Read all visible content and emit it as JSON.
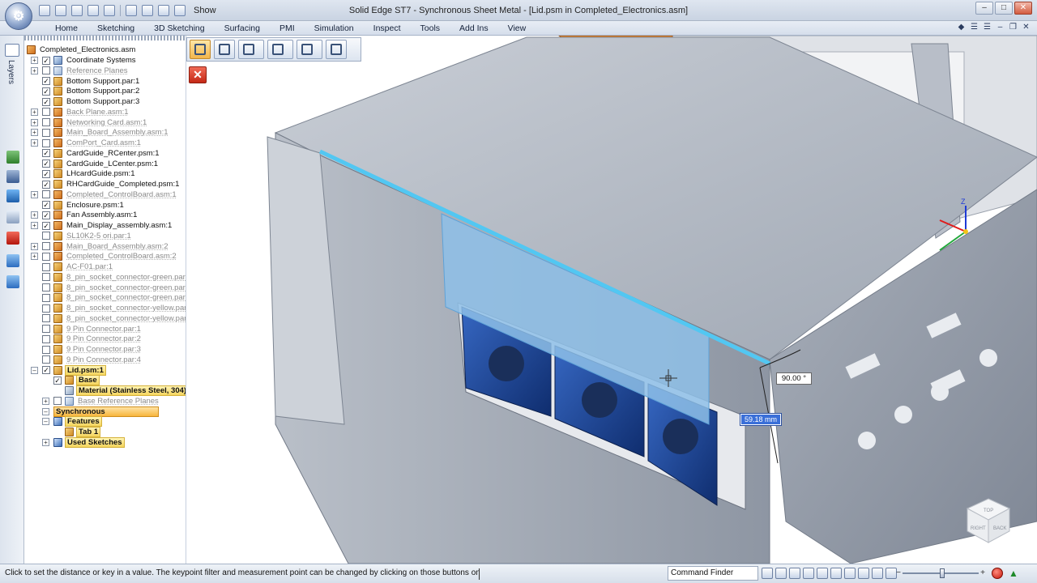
{
  "title_bar": {
    "app_title": "Solid Edge ST7 - Synchronous Sheet Metal - [Lid.psm in Completed_Electronics.asm]",
    "quick_access_show": "Show",
    "window_controls": [
      "–",
      "□",
      "✕"
    ]
  },
  "ribbon": {
    "tabs": [
      "Home",
      "Sketching",
      "3D Sketching",
      "Surfacing",
      "PMI",
      "Simulation",
      "Inspect",
      "Tools",
      "Add Ins",
      "View"
    ],
    "right_icons": [
      "◆",
      "☰",
      "☰",
      "–",
      "❐",
      "✕"
    ]
  },
  "left_toolbar": {
    "layers_label": "Layers"
  },
  "tree": {
    "root": "Completed_Electronics.asm",
    "items": [
      {
        "label": "Coordinate Systems",
        "checked": true,
        "expand": "+",
        "icon": "sys",
        "dim": false,
        "indent": 0
      },
      {
        "label": "Reference Planes",
        "checked": false,
        "expand": "+",
        "icon": "planes",
        "dim": true,
        "indent": 0
      },
      {
        "label": "Bottom Support.par:1",
        "checked": true,
        "expand": "",
        "icon": "part",
        "dim": false,
        "indent": 0
      },
      {
        "label": "Bottom Support.par:2",
        "checked": true,
        "expand": "",
        "icon": "part",
        "dim": false,
        "indent": 0
      },
      {
        "label": "Bottom Support.par:3",
        "checked": true,
        "expand": "",
        "icon": "part",
        "dim": false,
        "indent": 0
      },
      {
        "label": "Back Plane.asm:1",
        "checked": false,
        "expand": "+",
        "icon": "asm",
        "dim": true,
        "indent": 0
      },
      {
        "label": "Networking Card.asm:1",
        "checked": false,
        "expand": "+",
        "icon": "asm",
        "dim": true,
        "indent": 0
      },
      {
        "label": "Main_Board_Assembly.asm:1",
        "checked": false,
        "expand": "+",
        "icon": "asm",
        "dim": true,
        "indent": 0
      },
      {
        "label": "ComPort_Card.asm:1",
        "checked": false,
        "expand": "+",
        "icon": "asm",
        "dim": true,
        "indent": 0
      },
      {
        "label": "CardGuide_RCenter.psm:1",
        "checked": true,
        "expand": "",
        "icon": "part",
        "dim": false,
        "indent": 0
      },
      {
        "label": "CardGuide_LCenter.psm:1",
        "checked": true,
        "expand": "",
        "icon": "part",
        "dim": false,
        "indent": 0
      },
      {
        "label": "LHcardGuide.psm:1",
        "checked": true,
        "expand": "",
        "icon": "part",
        "dim": false,
        "indent": 0
      },
      {
        "label": "RHCardGuide_Completed.psm:1",
        "checked": true,
        "expand": "",
        "icon": "part",
        "dim": false,
        "indent": 0
      },
      {
        "label": "Completed_ControlBoard.asm:1",
        "checked": false,
        "expand": "+",
        "icon": "asm",
        "dim": true,
        "indent": 0
      },
      {
        "label": "Enclosure.psm:1",
        "checked": true,
        "expand": "",
        "icon": "part",
        "dim": false,
        "indent": 0
      },
      {
        "label": "Fan Assembly.asm:1",
        "checked": true,
        "expand": "+",
        "icon": "asm",
        "dim": false,
        "indent": 0
      },
      {
        "label": "Main_Display_assembly.asm:1",
        "checked": true,
        "expand": "+",
        "icon": "asm",
        "dim": false,
        "indent": 0
      },
      {
        "label": "SL10K2-5 ori.par:1",
        "checked": false,
        "expand": "",
        "icon": "part",
        "dim": true,
        "indent": 0
      },
      {
        "label": "Main_Board_Assembly.asm:2",
        "checked": false,
        "expand": "+",
        "icon": "asm",
        "dim": true,
        "indent": 0
      },
      {
        "label": "Completed_ControlBoard.asm:2",
        "checked": false,
        "expand": "+",
        "icon": "asm",
        "dim": true,
        "indent": 0
      },
      {
        "label": "AC-F01.par:1",
        "checked": false,
        "expand": "",
        "icon": "part",
        "dim": true,
        "indent": 0
      },
      {
        "label": "8_pin_socket_connector-green.par:1",
        "checked": false,
        "expand": "",
        "icon": "part",
        "dim": true,
        "indent": 0
      },
      {
        "label": "8_pin_socket_connector-green.par:2",
        "checked": false,
        "expand": "",
        "icon": "part",
        "dim": true,
        "indent": 0
      },
      {
        "label": "8_pin_socket_connector-green.par:3",
        "checked": false,
        "expand": "",
        "icon": "part",
        "dim": true,
        "indent": 0
      },
      {
        "label": "8_pin_socket_connector-yellow.par:",
        "checked": false,
        "expand": "",
        "icon": "part",
        "dim": true,
        "indent": 0
      },
      {
        "label": "8_pin_socket_connector-yellow.par:",
        "checked": false,
        "expand": "",
        "icon": "part",
        "dim": true,
        "indent": 0
      },
      {
        "label": "9 Pin Connector.par:1",
        "checked": false,
        "expand": "",
        "icon": "part",
        "dim": true,
        "indent": 0
      },
      {
        "label": "9 Pin Connector.par:2",
        "checked": false,
        "expand": "",
        "icon": "part",
        "dim": true,
        "indent": 0
      },
      {
        "label": "9 Pin Connector.par:3",
        "checked": false,
        "expand": "",
        "icon": "part",
        "dim": true,
        "indent": 0
      },
      {
        "label": "9 Pin Connector.par:4",
        "checked": false,
        "expand": "",
        "icon": "part",
        "dim": true,
        "indent": 0
      },
      {
        "label": "Lid.psm:1",
        "checked": true,
        "expand": "–",
        "icon": "part",
        "dim": false,
        "indent": 0,
        "style": "hl"
      },
      {
        "label": "Base",
        "checked": true,
        "expand": "",
        "icon": "part",
        "dim": false,
        "indent": 1,
        "style": "hl"
      },
      {
        "label": "Material (Stainless Steel, 304)",
        "checked": null,
        "expand": "",
        "icon": "mat",
        "dim": false,
        "indent": 2,
        "style": "hl"
      },
      {
        "label": "Base Reference Planes",
        "checked": false,
        "expand": "+",
        "icon": "planes",
        "dim": true,
        "indent": 1
      },
      {
        "label": "Synchronous",
        "checked": null,
        "expand": "–",
        "icon": "",
        "dim": false,
        "indent": 0,
        "style": "sync"
      },
      {
        "label": "Features",
        "checked": null,
        "expand": "–",
        "icon": "feat",
        "dim": false,
        "indent": 1,
        "style": "hl"
      },
      {
        "label": "Tab 1",
        "checked": null,
        "expand": "",
        "icon": "part",
        "dim": false,
        "indent": 2,
        "style": "hl"
      },
      {
        "label": "Used Sketches",
        "checked": null,
        "expand": "+",
        "icon": "feat",
        "dim": false,
        "indent": 1,
        "style": "hl"
      }
    ]
  },
  "command_bar": {
    "buttons": [
      "select-face",
      "properties",
      "keypoint-filter",
      "measurement-point",
      "dimension-side",
      "tab-extent"
    ]
  },
  "viewport": {
    "dim_angle": "90.00 °",
    "dim_distance": "59.18 mm",
    "view_cube_labels": [
      "TOP",
      "RIGHT",
      "BACK"
    ],
    "axis_labels": {
      "z": "Z"
    }
  },
  "status": {
    "prompt": "Click to set the distance or key in a value. The keypoint filter and measurement point can be changed by clicking on those buttons on Cor",
    "command_finder": "Command Finder",
    "zoom_level": 0.52
  },
  "colors": {
    "accent": "#f5c448",
    "selection_blue": "#6fb0e2",
    "highlight": "#3a6fd8"
  }
}
